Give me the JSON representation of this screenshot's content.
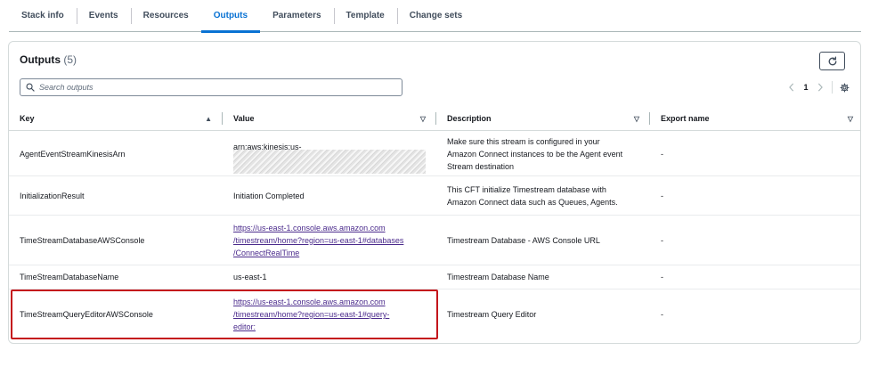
{
  "tabs": [
    {
      "label": "Stack info",
      "active": false
    },
    {
      "label": "Events",
      "active": false
    },
    {
      "label": "Resources",
      "active": false
    },
    {
      "label": "Outputs",
      "active": true
    },
    {
      "label": "Parameters",
      "active": false
    },
    {
      "label": "Template",
      "active": false
    },
    {
      "label": "Change sets",
      "active": false
    }
  ],
  "panel": {
    "title": "Outputs",
    "count": "(5)",
    "refresh_icon": "refresh-icon"
  },
  "search": {
    "placeholder": "Search outputs",
    "value": ""
  },
  "pagination": {
    "current_page": "1",
    "prev_icon": "chevron-left-icon",
    "next_icon": "chevron-right-icon",
    "settings_icon": "gear-icon"
  },
  "table": {
    "columns": [
      {
        "label": "Key",
        "sort": "▲"
      },
      {
        "label": "Value",
        "sort": "▽"
      },
      {
        "label": "Description",
        "sort": "▽"
      },
      {
        "label": "Export name",
        "sort": "▽"
      }
    ],
    "rows": [
      {
        "key": "AgentEventStreamKinesisArn",
        "value_lines": [
          "arn:aws:kinesis:us-"
        ],
        "value_is_link": false,
        "value_redacted": true,
        "description_lines": [
          "Make sure this stream is configured in your",
          "Amazon Connect instances to be the Agent event",
          "Stream destination"
        ],
        "export": "-"
      },
      {
        "key": "InitializationResult",
        "value_lines": [
          "Initiation Completed"
        ],
        "value_is_link": false,
        "value_redacted": false,
        "description_lines": [
          "This CFT initialize Timestream database with",
          "Amazon Connect data such as Queues, Agents."
        ],
        "export": "-"
      },
      {
        "key": "TimeStreamDatabaseAWSConsole",
        "value_lines": [
          "https://us-east-1.console.aws.amazon.com",
          "/timestream/home?region=us-east-1#databases",
          "/ConnectRealTime"
        ],
        "value_is_link": true,
        "value_redacted": false,
        "description_lines": [
          "Timestream Database - AWS Console URL"
        ],
        "export": "-"
      },
      {
        "key": "TimeStreamDatabaseName",
        "value_lines": [
          "us-east-1"
        ],
        "value_is_link": false,
        "value_redacted": false,
        "description_lines": [
          "Timestream Database Name"
        ],
        "export": "-"
      },
      {
        "key": "TimeStreamQueryEditorAWSConsole",
        "value_lines": [
          "https://us-east-1.console.aws.amazon.com",
          "/timestream/home?region=us-east-1#query-",
          "editor:"
        ],
        "value_is_link": true,
        "value_redacted": false,
        "description_lines": [
          "Timestream Query Editor"
        ],
        "export": "-",
        "highlighted": true
      }
    ]
  },
  "colors": {
    "accent": "#0972d3",
    "link_visited": "#4b2b8c",
    "highlight_border": "#c4161c"
  }
}
